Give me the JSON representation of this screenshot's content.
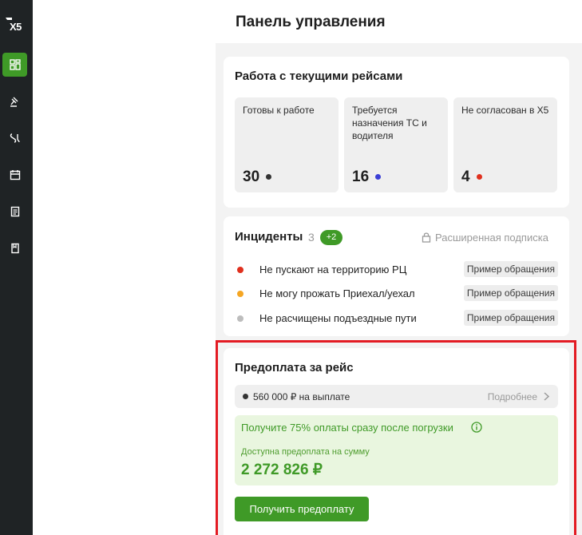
{
  "sidebar": {
    "logo": "X5",
    "items": [
      {
        "name": "dashboard",
        "active": true
      },
      {
        "name": "auction"
      },
      {
        "name": "routes"
      },
      {
        "name": "calendar"
      },
      {
        "name": "documents"
      },
      {
        "name": "guide"
      }
    ]
  },
  "header": {
    "title": "Панель управления"
  },
  "trips": {
    "title": "Работа с текущими рейсами",
    "tiles": [
      {
        "label": "Готовы к работе",
        "count": "30",
        "dot_color": "#333333"
      },
      {
        "label": "Требуется назначения ТС и водителя",
        "count": "16",
        "dot_color": "#3b3fd6"
      },
      {
        "label": "Не согласован в Х5",
        "count": "4",
        "dot_color": "#e0301e"
      }
    ]
  },
  "incidents": {
    "title": "Инциденты",
    "count": "3",
    "badge": "+2",
    "subscription": "Расширенная подписка",
    "items": [
      {
        "text": "Не пускают на территорию РЦ",
        "tag": "Пример обращения",
        "dot_color": "#e0301e"
      },
      {
        "text": "Не могу прожать Приехал/уехал",
        "tag": "Пример обращения",
        "dot_color": "#f5a623"
      },
      {
        "text": "Не расчищены подъездные пути",
        "tag": "Пример обращения",
        "dot_color": "#bdbdbd"
      }
    ]
  },
  "prepayment": {
    "title": "Предоплата за рейс",
    "payout_text": "560 000 ₽ на выплате",
    "details_link": "Подробнее",
    "offer_text": "Получите 75% оплаты сразу после погрузки",
    "available_label": "Доступна предоплата на сумму",
    "amount": "2 272 826 ₽",
    "button_label": "Получить предоплату"
  },
  "colors": {
    "accent_green": "#3f9a27",
    "highlight_red": "#e31b23",
    "sidebar_bg": "#1f2325"
  }
}
